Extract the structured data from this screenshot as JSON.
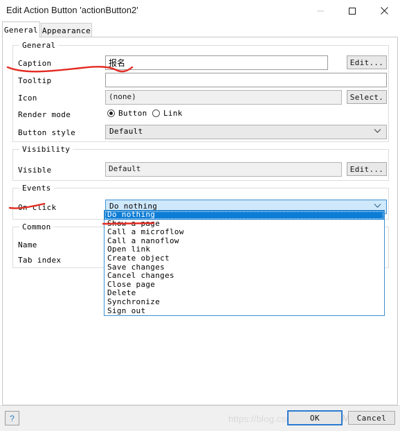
{
  "window": {
    "title": "Edit Action Button 'actionButton2'",
    "controls": [
      {
        "name": "minimize",
        "glyph": "minimize-icon",
        "disabled": true
      },
      {
        "name": "maximize",
        "glyph": "maximize-icon",
        "disabled": false
      },
      {
        "name": "close",
        "glyph": "close-icon",
        "disabled": false
      }
    ]
  },
  "tabs": [
    {
      "label": "General",
      "active": true
    },
    {
      "label": "Appearance",
      "active": false
    }
  ],
  "groups": {
    "general": {
      "title": "General",
      "caption": {
        "label": "Caption",
        "value": "报名",
        "button": "Edit..."
      },
      "tooltip": {
        "label": "Tooltip",
        "value": "",
        "placeholder": ""
      },
      "icon": {
        "label": "Icon",
        "value": "(none)",
        "button": "Select."
      },
      "render_mode": {
        "label": "Render mode",
        "options": [
          {
            "label": "Button",
            "selected": true
          },
          {
            "label": "Link",
            "selected": false
          }
        ]
      },
      "button_style": {
        "label": "Button style",
        "value": "Default"
      }
    },
    "visibility": {
      "title": "Visibility",
      "visible": {
        "label": "Visible",
        "value": "Default",
        "button": "Edit..."
      }
    },
    "events": {
      "title": "Events",
      "on_click": {
        "label": "On click",
        "value": "Do nothing",
        "expanded": true,
        "options": [
          "Do nothing",
          "Show a page",
          "Call a microflow",
          "Call a nanoflow",
          "Open link",
          "Create object",
          "Save changes",
          "Cancel changes",
          "Close page",
          "Delete",
          "Synchronize",
          "Sign out"
        ],
        "selected_index": 0
      }
    },
    "common": {
      "title": "Common",
      "name": {
        "label": "Name",
        "value": ""
      },
      "tab_index": {
        "label": "Tab index",
        "value": ""
      }
    }
  },
  "footer": {
    "help": "?",
    "ok": "OK",
    "cancel": "Cancel"
  },
  "watermarks": {
    "url": "https://blog.csdn.net/qq_4",
    "brand": "Mendix"
  },
  "colors": {
    "accent_blue": "#0c7cd5",
    "combo_open_fill": "#cfe8fb",
    "focus_border": "#2a7ad1",
    "annotation_red": "#e32b22",
    "window_bg": "#ffffff",
    "footer_bg": "#f0f0f0"
  }
}
